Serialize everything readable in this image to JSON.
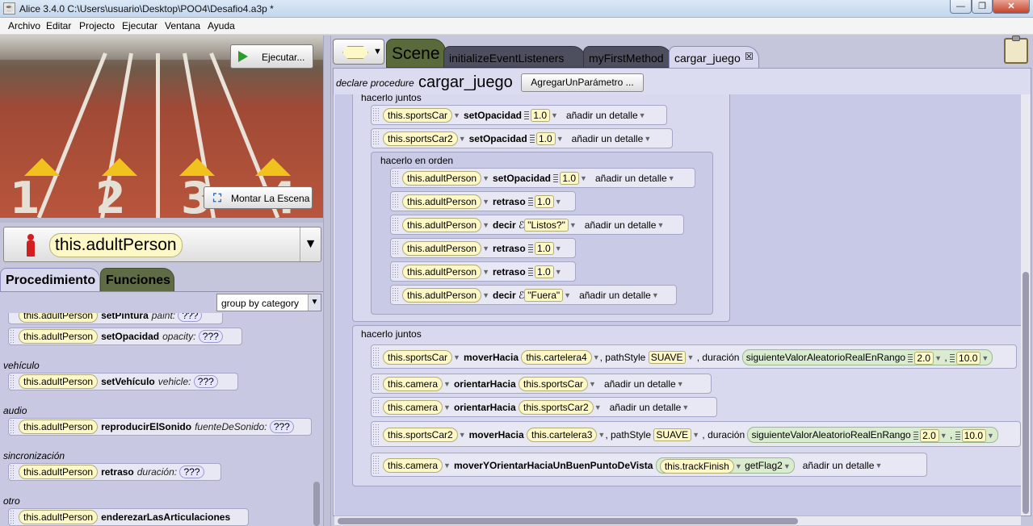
{
  "window": {
    "title": "Alice 3.4.0 C:\\Users\\usuario\\Desktop\\POO4\\Desafio4.a3p *"
  },
  "menu": [
    "Archivo",
    "Editar",
    "Projecto",
    "Ejecutar",
    "Ventana",
    "Ayuda"
  ],
  "scene": {
    "run_label": "Ejecutar...",
    "setup_label": "Montar La Escena",
    "lane_numbers": [
      "1",
      "2",
      "3",
      "4"
    ]
  },
  "object_selector": {
    "selected": "this.adultPerson"
  },
  "left_tabs": [
    "Procedimiento",
    "Funciones"
  ],
  "group_select": "group by category",
  "procedures": {
    "partial1": {
      "object": "this.adultPerson",
      "method": "setPintura",
      "param": "paint:",
      "value": "???"
    },
    "partial2": {
      "object": "this.adultPerson",
      "method": "setOpacidad",
      "param": "opacity:",
      "value": "???"
    },
    "cat_vehiculo": "vehículo",
    "vehiculo": {
      "object": "this.adultPerson",
      "method": "setVehículo",
      "param": "vehicle:",
      "value": "???"
    },
    "cat_audio": "audio",
    "audio": {
      "object": "this.adultPerson",
      "method": "reproducirElSonido",
      "param": "fuenteDeSonido:",
      "value": "???"
    },
    "cat_sinc": "sincronización",
    "sinc": {
      "object": "this.adultPerson",
      "method": "retraso",
      "param": "duración:",
      "value": "???"
    },
    "cat_otro": "otro",
    "otro": {
      "object": "this.adultPerson",
      "method": "enderezarLasArticulaciones"
    }
  },
  "editor_tabs": [
    "Scene",
    "initializeEventListeners",
    "myFirstMethod",
    "cargar_juego"
  ],
  "declare": {
    "prefix": "declare procedure",
    "name": "cargar_juego",
    "add_param": "AgregarUnParámetro ..."
  },
  "code": {
    "hacerlo_juntos": "hacerlo juntos",
    "hacerlo_en_orden": "hacerlo en orden",
    "detail": "añadir un detalle",
    "s1": {
      "obj": "this.sportsCar",
      "method": "setOpacidad",
      "value": "1.0"
    },
    "s2": {
      "obj": "this.sportsCar2",
      "method": "setOpacidad",
      "value": "1.0"
    },
    "o1": {
      "obj": "this.adultPerson",
      "method": "setOpacidad",
      "value": "1.0"
    },
    "o2": {
      "obj": "this.adultPerson",
      "method": "retraso",
      "value": "1.0"
    },
    "o3": {
      "obj": "this.adultPerson",
      "method": "decir",
      "value": "\"Listos?\""
    },
    "o4": {
      "obj": "this.adultPerson",
      "method": "retraso",
      "value": "1.0"
    },
    "o5": {
      "obj": "this.adultPerson",
      "method": "retraso",
      "value": "1.0"
    },
    "o6": {
      "obj": "this.adultPerson",
      "method": "decir",
      "value": "\"Fuera\""
    },
    "j1": {
      "obj": "this.sportsCar",
      "method": "moverHacia",
      "target": "this.cartelera4",
      "path_label": ", pathStyle",
      "path": "SUAVE",
      "dur_label": ", duración",
      "func": "siguienteValorAleatorioRealEnRango",
      "a": "2.0",
      "b": "10.0"
    },
    "j2": {
      "obj": "this.camera",
      "method": "orientarHacia",
      "target": "this.sportsCar"
    },
    "j3": {
      "obj": "this.camera",
      "method": "orientarHacia",
      "target": "this.sportsCar2"
    },
    "j4": {
      "obj": "this.sportsCar2",
      "method": "moverHacia",
      "target": "this.cartelera3",
      "path_label": ", pathStyle",
      "path": "SUAVE",
      "dur_label": ", duración",
      "func": "siguienteValorAleatorioRealEnRango",
      "a": "2.0",
      "b": "10.0"
    },
    "j5": {
      "obj": "this.camera",
      "method": "moverYOrientarHaciaUnBuenPuntoDeVista",
      "target": "this.trackFinish",
      "getter": "getFlag2"
    }
  },
  "colors": {
    "scene_tab": "#5a6a3a",
    "tab_active": "#d7d7ee",
    "code_bg": "#c8c9e6"
  }
}
